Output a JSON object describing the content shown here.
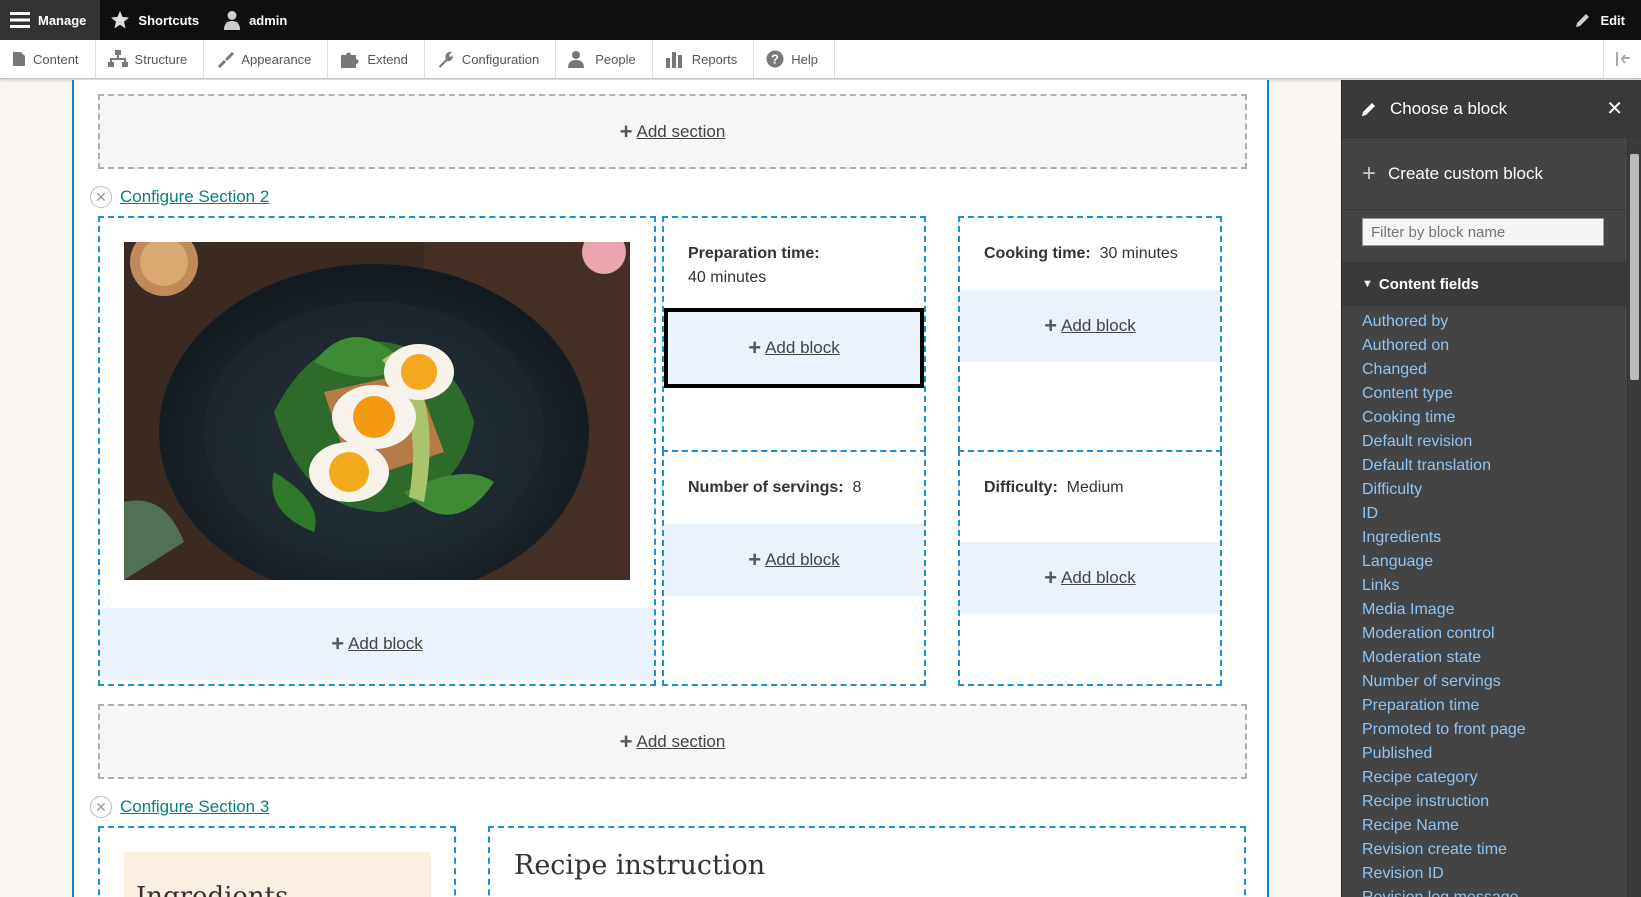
{
  "toolbar": {
    "manage": "Manage",
    "shortcuts": "Shortcuts",
    "user": "admin",
    "edit": "Edit"
  },
  "tray": {
    "items": [
      "Content",
      "Structure",
      "Appearance",
      "Extend",
      "Configuration",
      "People",
      "Reports",
      "Help"
    ]
  },
  "builder": {
    "add_section": "Add section",
    "add_block": "Add block",
    "section2": {
      "configure": "Configure Section 2",
      "prep_label": "Preparation time:",
      "prep_value": "40 minutes",
      "cook_label": "Cooking time:",
      "cook_value": "30 minutes",
      "servings_label": "Number of servings:",
      "servings_value": "8",
      "difficulty_label": "Difficulty:",
      "difficulty_value": "Medium"
    },
    "section3": {
      "configure": "Configure Section 3",
      "recipe_instruction": "Recipe instruction",
      "ingredients_partial": "Ingredients"
    }
  },
  "sidebar": {
    "title": "Choose a block",
    "create_custom": "Create custom block",
    "filter_placeholder": "Filter by block name",
    "section_title": "Content fields",
    "items": [
      "Authored by",
      "Authored on",
      "Changed",
      "Content type",
      "Cooking time",
      "Default revision",
      "Default translation",
      "Difficulty",
      "ID",
      "Ingredients",
      "Language",
      "Links",
      "Media Image",
      "Moderation control",
      "Moderation state",
      "Number of servings",
      "Preparation time",
      "Promoted to front page",
      "Published",
      "Recipe category",
      "Recipe instruction",
      "Recipe Name",
      "Revision create time",
      "Revision ID",
      "Revision log message"
    ]
  },
  "colors": {
    "accent_blue": "#1a8fd3",
    "link_teal": "#00857a",
    "sidebar_link": "#8cc4f5",
    "toolbar_bg": "#0f0f0f"
  }
}
